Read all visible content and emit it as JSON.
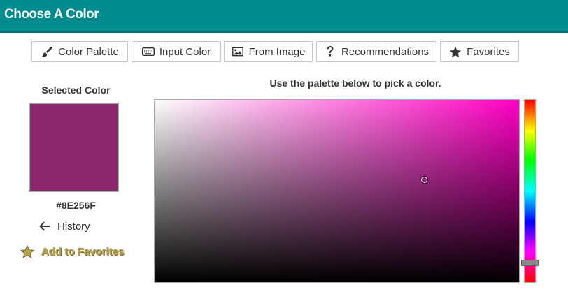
{
  "header": {
    "title": "Choose A Color",
    "color": "#008b8f"
  },
  "tabs": [
    {
      "label": "Color Palette",
      "icon": "brush-icon"
    },
    {
      "label": "Input Color",
      "icon": "keyboard-icon"
    },
    {
      "label": "From Image",
      "icon": "image-icon"
    },
    {
      "label": "Recommendations",
      "icon": "question-mark-icon"
    },
    {
      "label": "Favorites",
      "icon": "star-icon"
    }
  ],
  "selected": {
    "label": "Selected Color",
    "hex": "#8E256F",
    "color": "#8e256f"
  },
  "history": {
    "label": "History",
    "icon": "arrow-left-icon"
  },
  "favorites_link": {
    "label": "Add to Favorites",
    "icon": "star-icon",
    "color": "#b8a24a"
  },
  "palette": {
    "instruction": "Use the palette below to pick a color.",
    "hue_color": "#ff00c4",
    "saturation": 0.74,
    "brightness": 0.56
  },
  "hue_slider": {
    "hue_fraction": 0.89
  }
}
